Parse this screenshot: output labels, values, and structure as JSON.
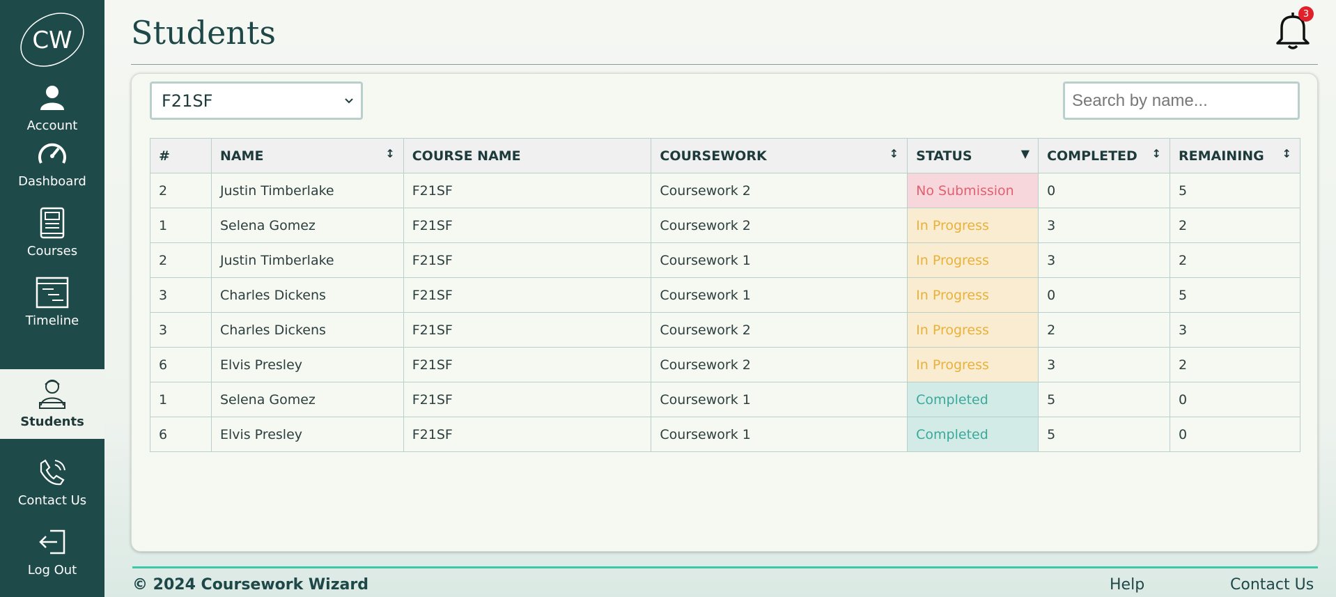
{
  "sidebar": {
    "logo_text": "CW",
    "items": [
      {
        "label": "Account",
        "icon": "user-icon"
      },
      {
        "label": "Dashboard",
        "icon": "gauge-icon"
      },
      {
        "label": "Courses",
        "icon": "book-icon"
      },
      {
        "label": "Timeline",
        "icon": "timeline-icon"
      },
      {
        "label": "Students",
        "icon": "student-icon",
        "active": true
      },
      {
        "label": "Contact Us",
        "icon": "phone-icon"
      },
      {
        "label": "Log Out",
        "icon": "logout-icon"
      }
    ]
  },
  "header": {
    "title": "Students",
    "notification_count": "3"
  },
  "filters": {
    "course_selected": "F21SF",
    "search_placeholder": "Search by name..."
  },
  "table": {
    "columns": [
      "#",
      "NAME",
      "COURSE NAME",
      "COURSEWORK",
      "STATUS",
      "COMPLETED",
      "REMAINING"
    ],
    "rows": [
      {
        "id": "2",
        "name": "Justin Timberlake",
        "course": "F21SF",
        "coursework": "Coursework 2",
        "status": "No Submission",
        "completed": "0",
        "remaining": "5"
      },
      {
        "id": "1",
        "name": "Selena Gomez",
        "course": "F21SF",
        "coursework": "Coursework 2",
        "status": "In Progress",
        "completed": "3",
        "remaining": "2"
      },
      {
        "id": "2",
        "name": "Justin Timberlake",
        "course": "F21SF",
        "coursework": "Coursework 1",
        "status": "In Progress",
        "completed": "3",
        "remaining": "2"
      },
      {
        "id": "3",
        "name": "Charles Dickens",
        "course": "F21SF",
        "coursework": "Coursework 1",
        "status": "In Progress",
        "completed": "0",
        "remaining": "5"
      },
      {
        "id": "3",
        "name": "Charles Dickens",
        "course": "F21SF",
        "coursework": "Coursework 2",
        "status": "In Progress",
        "completed": "2",
        "remaining": "3"
      },
      {
        "id": "6",
        "name": "Elvis Presley",
        "course": "F21SF",
        "coursework": "Coursework 2",
        "status": "In Progress",
        "completed": "3",
        "remaining": "2"
      },
      {
        "id": "1",
        "name": "Selena Gomez",
        "course": "F21SF",
        "coursework": "Coursework 1",
        "status": "Completed",
        "completed": "5",
        "remaining": "0"
      },
      {
        "id": "6",
        "name": "Elvis Presley",
        "course": "F21SF",
        "coursework": "Coursework 1",
        "status": "Completed",
        "completed": "5",
        "remaining": "0"
      }
    ]
  },
  "footer": {
    "copyright": "© 2024 Coursework Wizard",
    "help": "Help",
    "contact": "Contact Us"
  },
  "colors": {
    "sidebar": "#1e4b49",
    "accent": "#3cc9a6",
    "no_submission": "#e06070",
    "in_progress": "#e8b13a",
    "completed": "#3aa89a"
  }
}
